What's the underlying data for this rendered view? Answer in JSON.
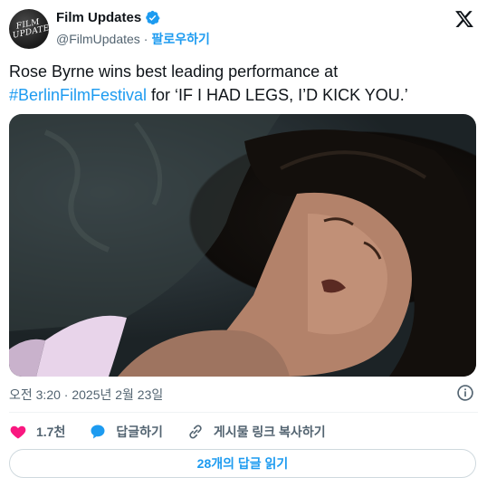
{
  "author": {
    "avatar_text": "FILM UPDATES",
    "display_name": "Film Updates",
    "handle": "@FilmUpdates",
    "separator": "·",
    "follow_label": "팔로우하기",
    "verified_icon": "verified-badge-icon"
  },
  "tweet": {
    "text_prefix": "Rose Byrne wins best leading performance at ",
    "hashtag": "#BerlinFilmFestival",
    "text_suffix": " for ‘IF I HAD LEGS, I’D KICK YOU.’",
    "timestamp": "오전 3:20 · 2025년 2월 23일"
  },
  "actions": {
    "likes": "1.7천",
    "reply_label": "답글하기",
    "share_label": "게시물 링크 복사하기"
  },
  "footer": {
    "read_replies": "28개의 답글 읽기"
  },
  "colors": {
    "accent": "#1d9bf0",
    "like": "#f91880",
    "text": "#0f1419",
    "secondary": "#536471"
  }
}
